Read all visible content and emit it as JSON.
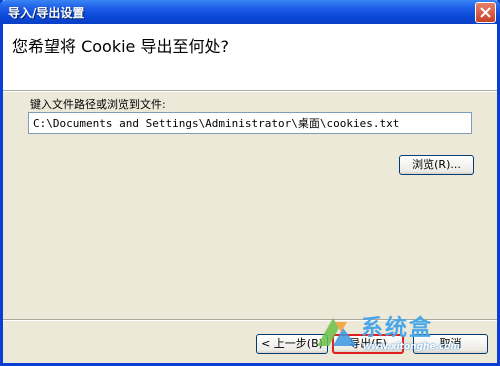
{
  "window": {
    "title": "导入/导出设置",
    "close_icon": "close-icon"
  },
  "header": {
    "question": "您希望将 Cookie 导出至何处?"
  },
  "path": {
    "label": "键入文件路径或浏览到文件:",
    "value": "C:\\Documents and Settings\\Administrator\\桌面\\cookies.txt"
  },
  "buttons": {
    "browse": "浏览(R)...",
    "back": "< 上一步(B)",
    "export": "导出(E)",
    "cancel": "取消"
  },
  "watermark": {
    "name": "系统盒",
    "url": "www.xitonghe.com"
  },
  "colors": {
    "titlebar": "#0a48d7",
    "dialog_bg": "#ece9d8",
    "highlight": "#e02020"
  }
}
